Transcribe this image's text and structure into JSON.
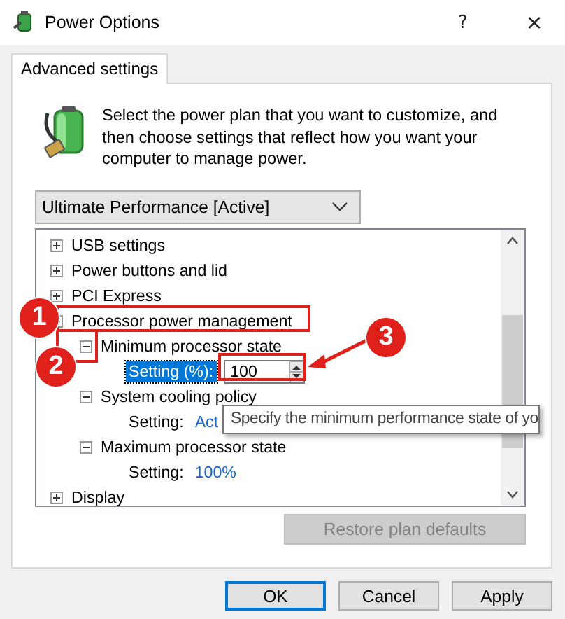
{
  "window": {
    "title": "Power Options",
    "help": "?",
    "close": "×"
  },
  "tabs": [
    {
      "label": "Advanced settings",
      "selected": true
    }
  ],
  "intro": "Select the power plan that you want to customize, and then choose settings that reflect how you want your computer to manage power.",
  "plan_dropdown": {
    "value": "Ultimate Performance [Active]"
  },
  "tree": [
    {
      "label": "USB settings",
      "expanded": false
    },
    {
      "label": "Power buttons and lid",
      "expanded": false
    },
    {
      "label": "PCI Express",
      "expanded": false
    },
    {
      "label": "Processor power management",
      "expanded": true,
      "children": [
        {
          "label": "Minimum processor state",
          "expanded": true,
          "children": [
            {
              "kind": "spin",
              "label": "Setting (%):",
              "value": "100",
              "selected": true
            }
          ]
        },
        {
          "label": "System cooling policy",
          "expanded": true,
          "children": [
            {
              "kind": "setting",
              "label": "Setting:",
              "value": "Act",
              "selected": false
            }
          ]
        },
        {
          "label": "Maximum processor state",
          "expanded": true,
          "children": [
            {
              "kind": "setting",
              "label": "Setting:",
              "value": "100%",
              "selected": false
            }
          ]
        }
      ]
    },
    {
      "label": "Display",
      "expanded": false
    }
  ],
  "tooltip": "Specify the minimum performance state of yo",
  "restore_button": {
    "label": "Restore plan defaults",
    "disabled": true
  },
  "buttons": [
    {
      "label": "OK",
      "default": true
    },
    {
      "label": "Cancel",
      "default": false
    },
    {
      "label": "Apply",
      "default": false
    }
  ],
  "annotations": [
    "1",
    "2",
    "3"
  ]
}
